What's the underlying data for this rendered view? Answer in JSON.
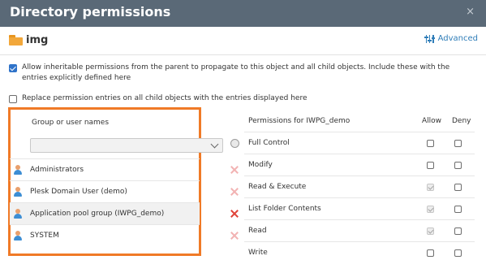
{
  "dialog": {
    "title": "Directory permissions",
    "close_symbol": "×",
    "close_icon": "close-icon"
  },
  "object": {
    "name": "img",
    "icon": "folder-icon",
    "folder_color": "#f2a73a"
  },
  "advanced": {
    "label": "Advanced",
    "icon": "sliders-icon",
    "color": "#2f7db8"
  },
  "options": {
    "inherit": {
      "checked": true,
      "label": "Allow inheritable permissions from the parent to propagate to this object and all child objects. Include these with the entries explicitly defined here"
    },
    "replace": {
      "checked": false,
      "label": "Replace permission entries on all child objects with the entries displayed here"
    }
  },
  "users": {
    "header": "Group or user names",
    "select_value": "",
    "highlight_color": "#f07a27",
    "items": [
      {
        "name": "Administrators",
        "icon": "user-icon",
        "selected": false
      },
      {
        "name": "Plesk Domain User (demo)",
        "icon": "user-icon",
        "selected": false
      },
      {
        "name": "Application pool group (IWPG_demo)",
        "icon": "user-icon",
        "selected": true
      },
      {
        "name": "SYSTEM",
        "icon": "user-icon",
        "selected": false
      }
    ]
  },
  "permissions": {
    "header": "Permissions for IWPG_demo",
    "allow_header": "Allow",
    "deny_header": "Deny",
    "items": [
      {
        "label": "Full Control",
        "allow": "unchecked",
        "deny": "unchecked"
      },
      {
        "label": "Modify",
        "allow": "unchecked",
        "deny": "unchecked"
      },
      {
        "label": "Read & Execute",
        "allow": "inherited",
        "deny": "unchecked"
      },
      {
        "label": "List Folder Contents",
        "allow": "inherited",
        "deny": "unchecked"
      },
      {
        "label": "Read",
        "allow": "inherited",
        "deny": "unchecked"
      },
      {
        "label": "Write",
        "allow": "unchecked",
        "deny": "unchecked"
      }
    ]
  }
}
